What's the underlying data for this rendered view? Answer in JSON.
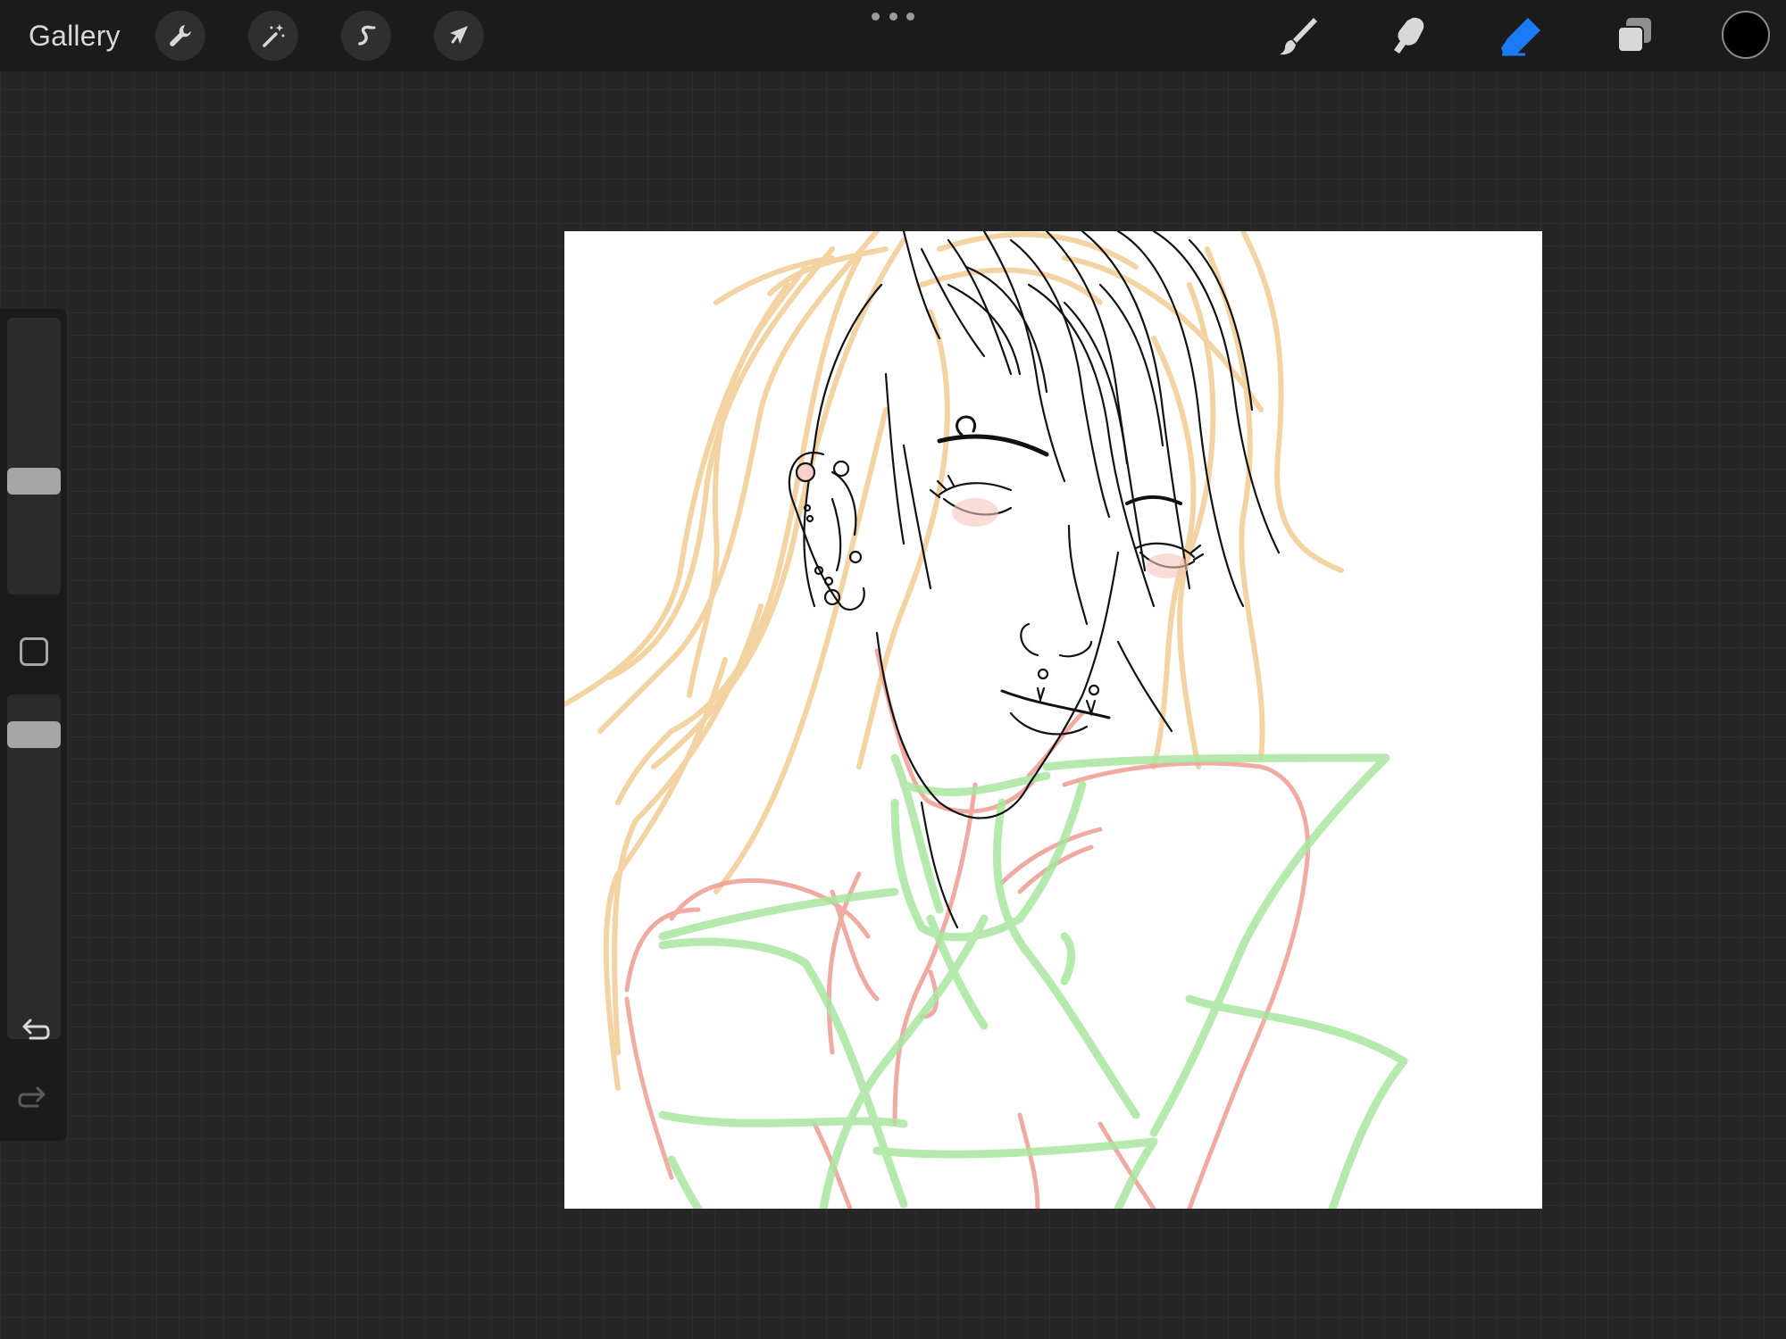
{
  "toolbar": {
    "gallery_label": "Gallery",
    "left_tools": [
      {
        "name": "actions",
        "icon": "wrench-icon"
      },
      {
        "name": "adjustments",
        "icon": "magic-wand-icon"
      },
      {
        "name": "selection",
        "icon": "selection-s-icon"
      },
      {
        "name": "transform",
        "icon": "arrow-cursor-icon"
      }
    ],
    "more_icon": "more-dots-icon",
    "right_tools": [
      {
        "name": "brush",
        "icon": "brush-icon",
        "active": false
      },
      {
        "name": "smudge",
        "icon": "smudge-finger-icon",
        "active": false
      },
      {
        "name": "eraser",
        "icon": "eraser-icon",
        "active": true
      },
      {
        "name": "layers",
        "icon": "layers-icon",
        "active": false
      }
    ],
    "active_color": "#000000",
    "active_tool_color": "#1a7cf5"
  },
  "sidebar": {
    "brush_size_level": 0.62,
    "opacity_level": 0.85,
    "modify_icon": "modify-square-icon",
    "undo_icon": "undo-icon",
    "redo_icon": "redo-icon"
  },
  "canvas": {
    "background": "#ffffff",
    "sketch_colors": {
      "hair": "#f3cf9a",
      "skin_guide": "#ef9c92",
      "structure_guide": "#a9e6a0",
      "lineart": "#111111"
    }
  }
}
